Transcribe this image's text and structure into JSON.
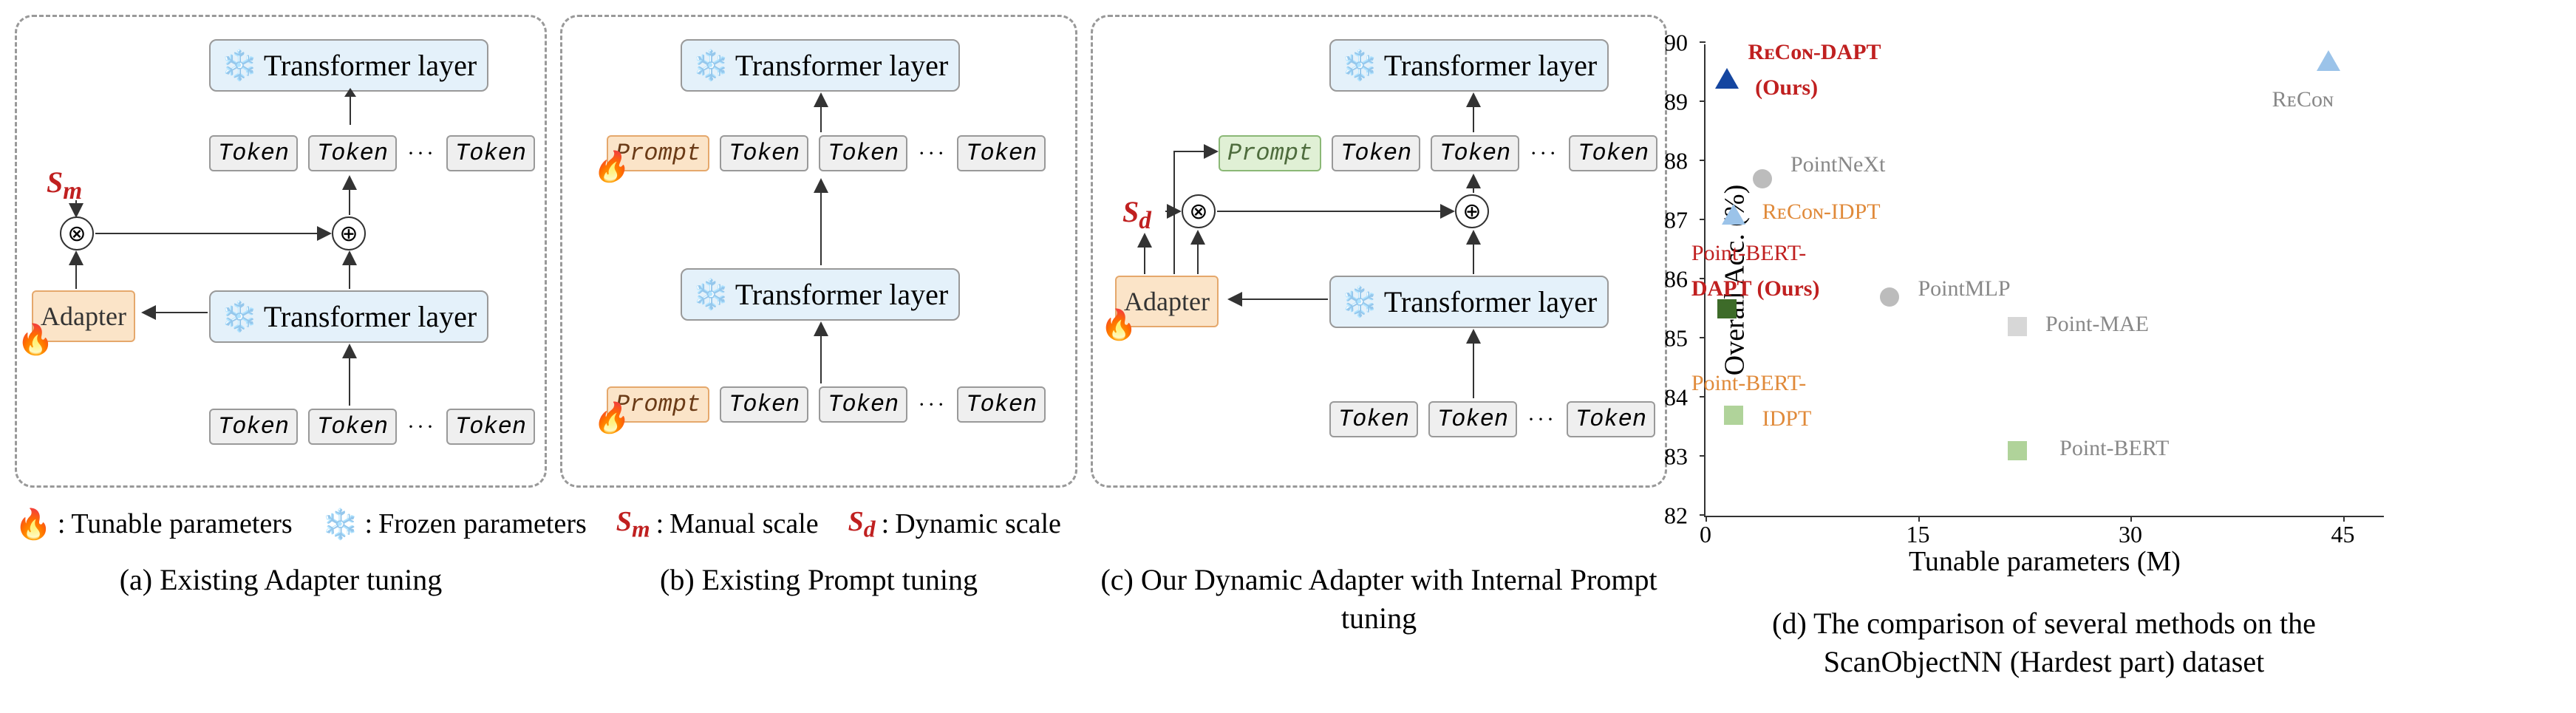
{
  "diagrams": {
    "transformer_label": "Transformer layer",
    "token_label": "Token",
    "dots": "···",
    "prompt_label": "Prompt",
    "adapter_label": "Adapter",
    "sm_label": "Sₘ",
    "sd_label": "S_d",
    "times_symbol": "⊗",
    "plus_symbol": "⊕"
  },
  "legend": {
    "tunable": "Tunable parameters",
    "frozen": "Frozen parameters",
    "sm_label": "Sₘ",
    "sm_desc": "Manual scale",
    "sd_label": "S_d",
    "sd_desc": "Dynamic scale",
    "fire_glyph": "🔥",
    "snow_glyph": "❄️"
  },
  "captions": {
    "a": "(a) Existing Adapter tuning",
    "b": "(b) Existing Prompt tuning",
    "c": "(c) Our Dynamic Adapter with Internal Prompt tuning",
    "d": "(d) The comparison of several methods on the ScanObjectNN (Hardest part) dataset"
  },
  "chart_data": {
    "type": "scatter",
    "title": "",
    "xlabel": "Tunable parameters (M)",
    "ylabel": "Overall Acc. (%)",
    "xlim": [
      0,
      48
    ],
    "ylim": [
      82,
      90
    ],
    "xticks": [
      0,
      15,
      30,
      45
    ],
    "yticks": [
      82,
      83,
      84,
      85,
      86,
      87,
      88,
      89,
      90
    ],
    "points": [
      {
        "name": "ReCon-DAPT (Ours)",
        "x": 1.5,
        "y": 89.4,
        "shape": "triangle",
        "color": "#1546a0",
        "label_color": "#c02020"
      },
      {
        "name": "ReCon",
        "x": 44,
        "y": 89.7,
        "shape": "triangle",
        "color": "#9bc3e9",
        "label_color": "#888"
      },
      {
        "name": "PointNeXt",
        "x": 4,
        "y": 87.7,
        "shape": "circle",
        "color": "#bcbcbc",
        "label_color": "#888"
      },
      {
        "name": "ReCon-IDPT",
        "x": 2,
        "y": 87.1,
        "shape": "triangle",
        "color": "#9bc3e9",
        "label_color": "#e08a3a"
      },
      {
        "name": "Point-BERT-DAPT (Ours)",
        "x": 1.5,
        "y": 85.5,
        "shape": "square",
        "color": "#3d6b29",
        "label_color": "#c02020"
      },
      {
        "name": "PointMLP",
        "x": 13,
        "y": 85.7,
        "shape": "circle",
        "color": "#bcbcbc",
        "label_color": "#888"
      },
      {
        "name": "Point-MAE",
        "x": 22,
        "y": 85.2,
        "shape": "square",
        "color": "#d7d7d7",
        "label_color": "#888"
      },
      {
        "name": "Point-BERT-IDPT",
        "x": 2,
        "y": 83.7,
        "shape": "square",
        "color": "#b0d39a",
        "label_color": "#e08a3a"
      },
      {
        "name": "Point-BERT",
        "x": 22,
        "y": 83.1,
        "shape": "square",
        "color": "#b0d39a",
        "label_color": "#888"
      }
    ]
  },
  "point_labels": {
    "recon_dapt1": "RᴇCᴏɴ-DAPT",
    "recon_dapt2": "(Ours)",
    "recon": "RᴇCᴏɴ",
    "pointnext": "PointNeXt",
    "recon_idpt": "RᴇCᴏɴ-IDPT",
    "pb_dapt1": "Point-BERT-",
    "pb_dapt2": "DAPT (Ours)",
    "pointmlp": "PointMLP",
    "pointmae": "Point-MAE",
    "pb_idpt1": "Point-BERT-",
    "pb_idpt2": "IDPT",
    "pointbert": "Point-BERT"
  }
}
